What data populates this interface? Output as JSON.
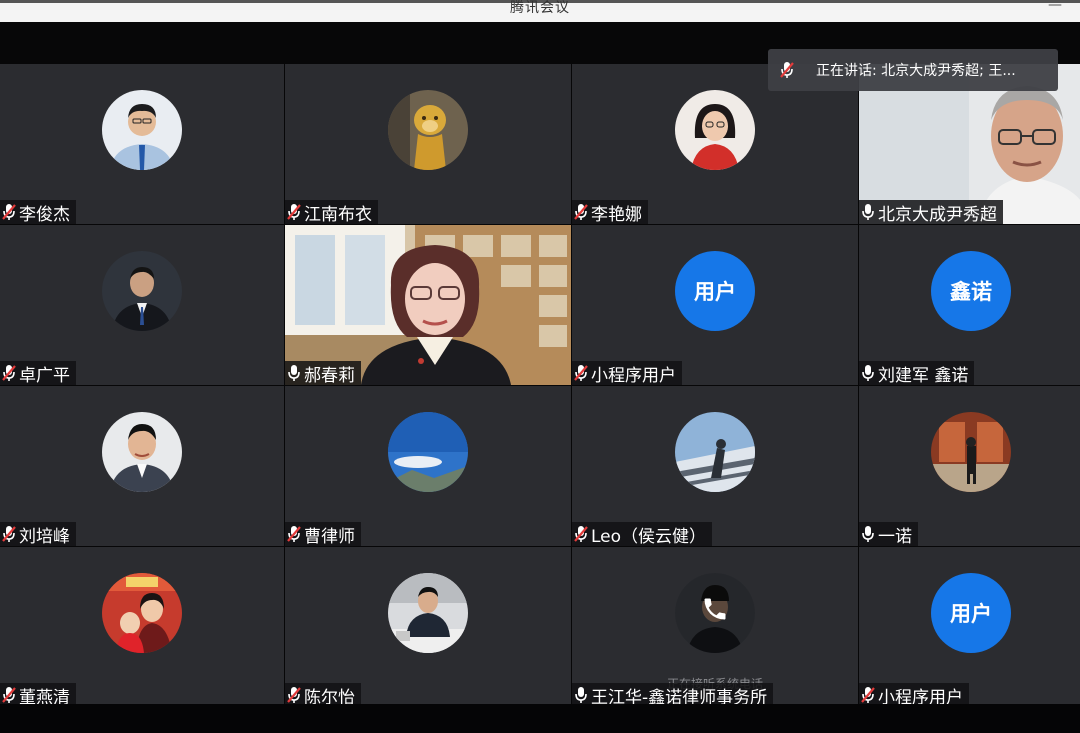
{
  "window": {
    "title": "腾讯会议",
    "minimize": "—"
  },
  "speaking": {
    "label": "正在讲话: 北京大成尹秀超; 王..."
  },
  "participants": [
    {
      "name": "李俊杰",
      "mic": "muted",
      "avatar": "photo-man-suit"
    },
    {
      "name": "江南布衣",
      "mic": "muted",
      "avatar": "photo-lion"
    },
    {
      "name": "李艳娜",
      "mic": "muted",
      "avatar": "photo-woman-glasses"
    },
    {
      "name": "北京大成尹秀超",
      "mic": "on",
      "avatar": "video"
    },
    {
      "name": "卓广平",
      "mic": "muted",
      "avatar": "photo-man-dark"
    },
    {
      "name": "郝春莉",
      "mic": "on",
      "avatar": "video"
    },
    {
      "name": "小程序用户",
      "mic": "muted",
      "avatar_text": "用户"
    },
    {
      "name": "刘建军 鑫诺",
      "mic": "on",
      "avatar_text": "鑫诺"
    },
    {
      "name": "刘培峰",
      "mic": "muted",
      "avatar": "photo-man-smile"
    },
    {
      "name": "曹律师",
      "mic": "muted",
      "avatar": "photo-sky"
    },
    {
      "name": "Leo（侯云健）",
      "mic": "muted",
      "avatar": "photo-snow"
    },
    {
      "name": "一诺",
      "mic": "on",
      "avatar": "photo-temple"
    },
    {
      "name": "董燕清",
      "mic": "muted",
      "avatar": "photo-family"
    },
    {
      "name": "陈尔怡",
      "mic": "muted",
      "avatar": "photo-meeting"
    },
    {
      "name": "王江华-鑫诺律师事务所",
      "mic": "on",
      "avatar": "photo-phone",
      "status": "正在接听系统电话"
    },
    {
      "name": "小程序用户",
      "mic": "muted",
      "avatar_text": "用户"
    }
  ],
  "colors": {
    "tile": "#2b2c30",
    "avatar_blue": "#1677e8",
    "muted_red": "#e23b3b"
  }
}
